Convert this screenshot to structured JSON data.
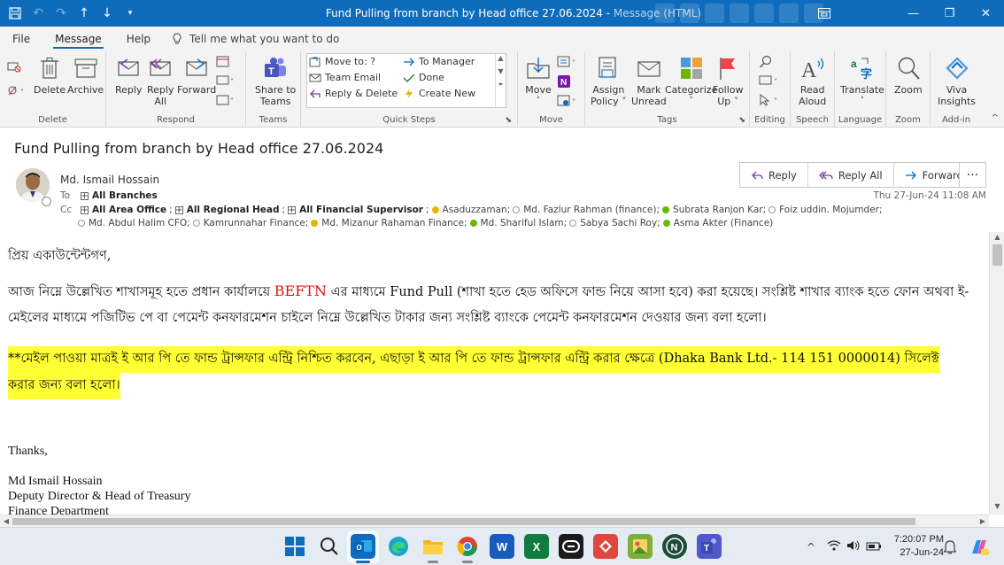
{
  "window": {
    "title": "Fund Pulling from branch by Head office 27.06.2024",
    "title_sep": " - ",
    "mode": "Message (HTML)"
  },
  "tabs": [
    {
      "label": "File"
    },
    {
      "label": "Message"
    },
    {
      "label": "Help"
    }
  ],
  "tellme": {
    "placeholder": "Tell me what you want to do"
  },
  "ribbon": {
    "groups": {
      "delete": "Delete",
      "respond": "Respond",
      "teams": "Teams",
      "quicksteps": "Quick Steps",
      "move": "Move",
      "tags": "Tags",
      "editing": "Editing",
      "speech": "Speech",
      "language": "Language",
      "zoom": "Zoom",
      "addin": "Add-in"
    },
    "buttons": {
      "delete": "Delete",
      "archive": "Archive",
      "reply": "Reply",
      "reply_all_1": "Reply",
      "reply_all_2": "All",
      "forward": "Forward",
      "share_1": "Share to",
      "share_2": "Teams",
      "move": "Move",
      "assign_1": "Assign",
      "assign_2": "Policy ˅",
      "mark_1": "Mark",
      "mark_2": "Unread",
      "categorize": "Categorize",
      "follow_1": "Follow",
      "follow_2": "Up ˅",
      "read_1": "Read",
      "read_2": "Aloud",
      "translate": "Translate",
      "zoom": "Zoom",
      "viva_1": "Viva",
      "viva_2": "Insights"
    },
    "quicksteps": [
      "Move to: ?",
      "Team Email",
      "Reply & Delete",
      "To Manager",
      "Done",
      "Create New"
    ]
  },
  "message": {
    "subject": "Fund Pulling from branch by Head office 27.06.2024",
    "sender": "Md. Ismail  Hossain",
    "to_label": "To",
    "cc_label": "Cc",
    "to": "All Branches",
    "cc_groups": [
      "All Area Office",
      "All Regional Head",
      "All Financial Supervisor"
    ],
    "cc_line1": [
      "Asaduzzaman;",
      "Md. Fazlur Rahman (finance);",
      "Subrata  Ranjon Kar;",
      "Foiz uddin. Mojumder;"
    ],
    "cc_line2": [
      "Md. Abdul Halim CFO;",
      "Kamrunnahar Finance;",
      "Md. Mizanur Rahaman Finance;",
      "Md. Shariful Islam;",
      "Sabya Sachi Roy;",
      "Asma  Akter (Finance)"
    ],
    "datetime": "Thu 27-Jun-24 11:08 AM",
    "actions": {
      "reply": "Reply",
      "reply_all": "Reply All",
      "forward": "Forward",
      "more": "···"
    }
  },
  "body": {
    "greeting": "প্রিয় একাউন্টেন্টগণ,",
    "p1_a": "আজ নিম্নে উল্লেখিত শাখাসমূহ হতে প্রধান কার্যালয়ে ",
    "p1_red": "BEFTN",
    "p1_b": " এর মাধ্যমে Fund Pull (শাখা হতে হেড অফিসে ফান্ড নিয়ে আসা হবে) করা হয়েছে। সংশ্লিষ্ট শাখার ব্যাংক হতে ফোন অথবা ই-",
    "p1_line2": "মেইলের মাধ্যমে পজিটিভ পে বা পেমেন্ট কনফারমেশন চাইলে নিম্নে উল্লেখিত টাকার জন্য সংশ্লিষ্ট ব্যাংকে পেমেন্ট কনফারমেশন দেওয়ার জন্য বলা হলো।",
    "hl_line1": "**মেইল পাওয়া মাত্রই ই আর পি তে  ফান্ড ট্রান্সফার এন্ট্রি নিশ্চিত করবেন, এছাড়া ই আর পি তে ফান্ড ট্রান্সফার এন্ট্রি করার ক্ষেত্রে (Dhaka Bank Ltd.- 114 151 0000014) সিলেক্ট",
    "hl_line2": "করার জন্য বলা হলো।",
    "thanks": "Thanks,",
    "sig_name": "Md Ismail Hossain",
    "sig_title": "Deputy Director & Head of Treasury",
    "sig_dept": "Finance Department"
  },
  "taskbar": {
    "word_label": "W",
    "excel_label": "X",
    "clock_time": "7:20:07 PM",
    "clock_date": "27-Jun-24"
  }
}
